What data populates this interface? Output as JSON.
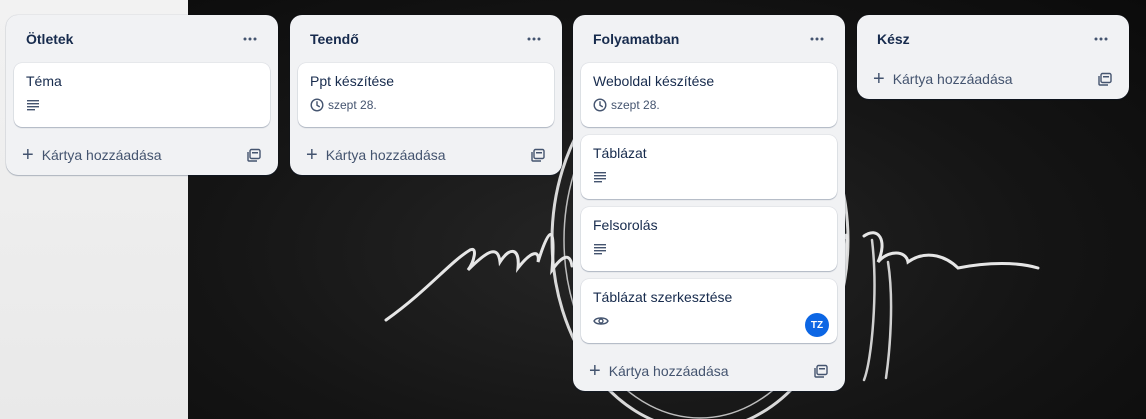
{
  "lists": [
    {
      "title": "Ötletek",
      "add_label": "Kártya hozzáadása",
      "cards": [
        {
          "title": "Téma",
          "description_icon": "description-icon"
        }
      ]
    },
    {
      "title": "Teendő",
      "add_label": "Kártya hozzáadása",
      "cards": [
        {
          "title": "Ppt készítése",
          "due": "szept 28."
        }
      ]
    },
    {
      "title": "Folyamatban",
      "add_label": "Kártya hozzáadása",
      "cards": [
        {
          "title": "Weboldal készítése",
          "due": "szept 28."
        },
        {
          "title": "Táblázat",
          "description_icon": "description-icon"
        },
        {
          "title": "Felsorolás",
          "description_icon": "description-icon"
        },
        {
          "title": "Táblázat szerkesztése",
          "watch_icon": "eye-icon",
          "member_initials": "TZ"
        }
      ]
    },
    {
      "title": "Kész",
      "add_label": "Kártya hozzáadása",
      "cards": []
    }
  ],
  "colors": {
    "list_bg": "#f1f2f4",
    "title_text": "#172b4d",
    "muted_text": "#44546f",
    "avatar_bg": "#0c66e4"
  }
}
